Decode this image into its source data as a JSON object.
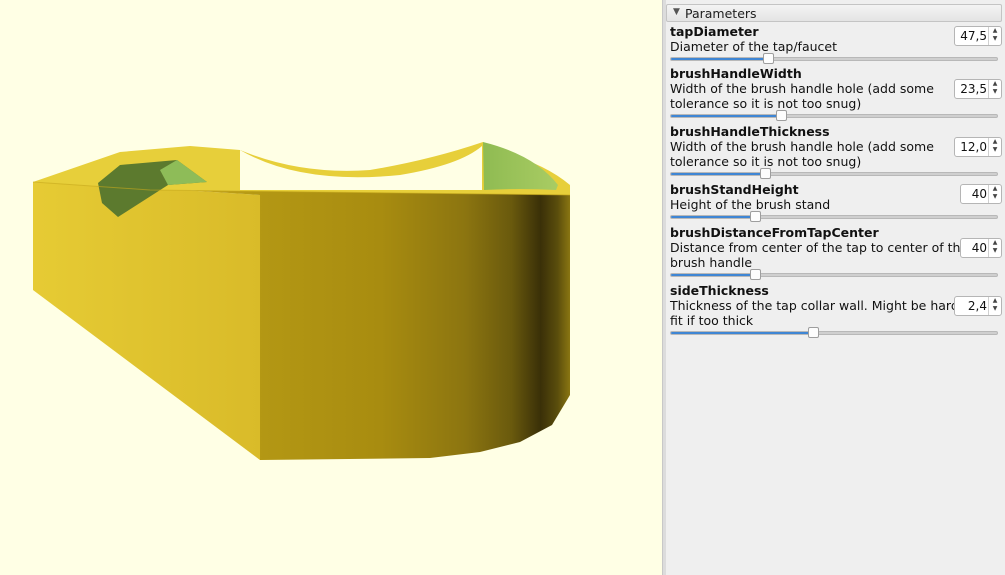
{
  "panel": {
    "title": "Parameters",
    "collapse_icon": "triangle-down-icon",
    "params": [
      {
        "name": "tapDiameter",
        "description": "Diameter of the tap/faucet",
        "value": "47,5",
        "fraction": 0.3
      },
      {
        "name": "brushHandleWidth",
        "description": "Width of the brush handle hole (add some\ntolerance so it is not too snug)",
        "value": "23,5",
        "fraction": 0.34
      },
      {
        "name": "brushHandleThickness",
        "description": "Width of the brush handle hole (add some\ntolerance so it is not too snug)",
        "value": "12,0",
        "fraction": 0.29
      },
      {
        "name": "brushStandHeight",
        "description": "Height of the brush stand",
        "value": "40",
        "fraction": 0.26
      },
      {
        "name": "brushDistanceFromTapCenter",
        "description": "Distance from center of the tap to center of the\nbrush handle",
        "value": "40",
        "fraction": 0.26
      },
      {
        "name": "sideThickness",
        "description": "Thickness of the tap collar wall. Might be hard to\nfit if too thick",
        "value": "2,4",
        "fraction": 0.44
      }
    ]
  },
  "colors": {
    "viewport_bg": "#ffffe5",
    "model_yellow": "#e3c52c",
    "model_inner_green": "#8fba4e",
    "slider_fill": "#3f86d4"
  }
}
